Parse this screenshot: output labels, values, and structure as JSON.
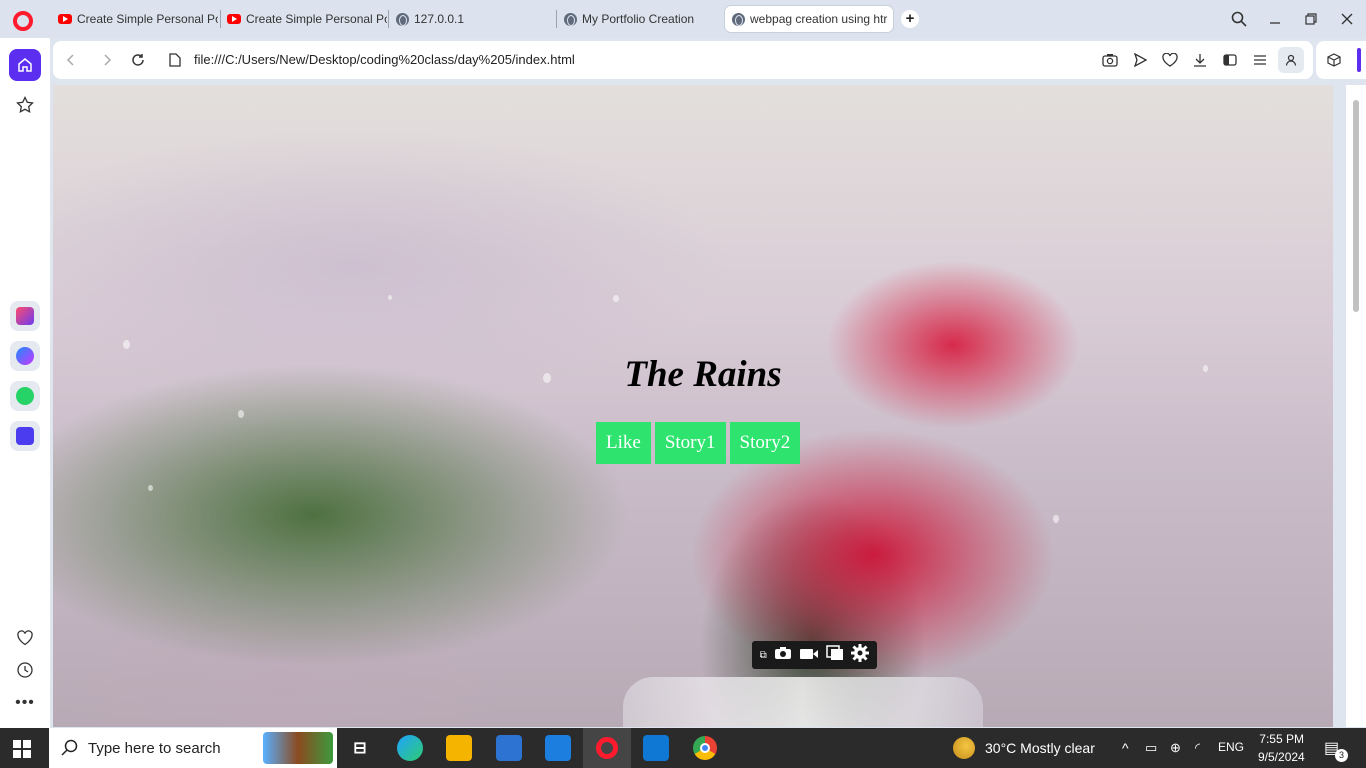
{
  "browser": {
    "tabs": [
      {
        "label": "Create Simple Personal Po",
        "icon": "youtube-icon",
        "active": false
      },
      {
        "label": "Create Simple Personal Po",
        "icon": "youtube-icon",
        "active": false
      },
      {
        "label": "127.0.0.1",
        "icon": "globe-icon",
        "active": false
      },
      {
        "label": "My Portfolio Creation",
        "icon": "globe-icon",
        "active": false
      },
      {
        "label": "webpag creation using htr",
        "icon": "globe-icon",
        "active": true
      }
    ],
    "new_tab_label": "+",
    "url": "file:///C:/Users/New/Desktop/coding%20class/day%205/index.html",
    "accent_color": "#5b2ef0"
  },
  "page": {
    "title": "The Rains",
    "buttons": [
      "Like",
      "Story1",
      "Story2"
    ],
    "button_color": "#2ee46e"
  },
  "taskbar": {
    "search_placeholder": "Type here to search",
    "weather": "30°C  Mostly clear",
    "language": "ENG",
    "time": "7:55 PM",
    "date": "9/5/2024",
    "notification_count": "3"
  }
}
